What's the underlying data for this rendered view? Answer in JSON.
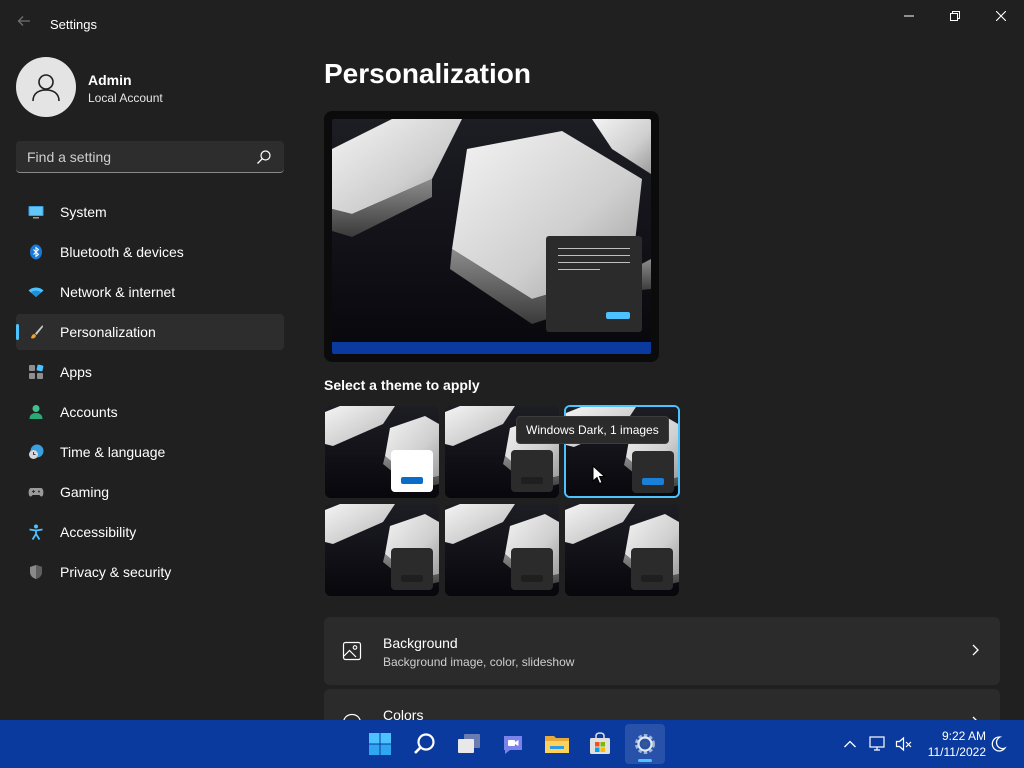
{
  "window": {
    "app_title": "Settings"
  },
  "user": {
    "name": "Admin",
    "account_type": "Local Account"
  },
  "search": {
    "placeholder": "Find a setting",
    "value": ""
  },
  "sidebar": {
    "items": [
      {
        "label": "System",
        "icon": "system-icon"
      },
      {
        "label": "Bluetooth & devices",
        "icon": "bluetooth-icon"
      },
      {
        "label": "Network & internet",
        "icon": "wifi-icon"
      },
      {
        "label": "Personalization",
        "icon": "brush-icon",
        "active": true
      },
      {
        "label": "Apps",
        "icon": "apps-icon"
      },
      {
        "label": "Accounts",
        "icon": "accounts-icon"
      },
      {
        "label": "Time & language",
        "icon": "time-language-icon"
      },
      {
        "label": "Gaming",
        "icon": "gamepad-icon"
      },
      {
        "label": "Accessibility",
        "icon": "accessibility-icon"
      },
      {
        "label": "Privacy & security",
        "icon": "shield-icon"
      }
    ]
  },
  "main": {
    "page_title": "Personalization",
    "theme_heading": "Select a theme to apply",
    "tooltip": "Windows Dark, 1 images",
    "themes": [
      {
        "mode": "light",
        "selected": false
      },
      {
        "mode": "dark",
        "selected": false
      },
      {
        "mode": "dark",
        "selected": true
      },
      {
        "mode": "dark",
        "selected": false
      },
      {
        "mode": "dark",
        "selected": false
      },
      {
        "mode": "dark",
        "selected": false
      }
    ],
    "settings": [
      {
        "title": "Background",
        "subtitle": "Background image, color, slideshow",
        "icon": "image-icon"
      },
      {
        "title": "Colors",
        "subtitle": "",
        "icon": "palette-icon"
      }
    ]
  },
  "taskbar": {
    "apps": [
      "start-icon",
      "search-icon",
      "task-view-icon",
      "chat-icon",
      "file-explorer-icon",
      "store-icon",
      "settings-icon"
    ],
    "time": "9:22 AM",
    "date": "11/11/2022"
  },
  "colors": {
    "background": "#202020",
    "accent": "#4cc2ff",
    "taskbar": "#0b3a9e",
    "card": "#2b2b2b"
  }
}
